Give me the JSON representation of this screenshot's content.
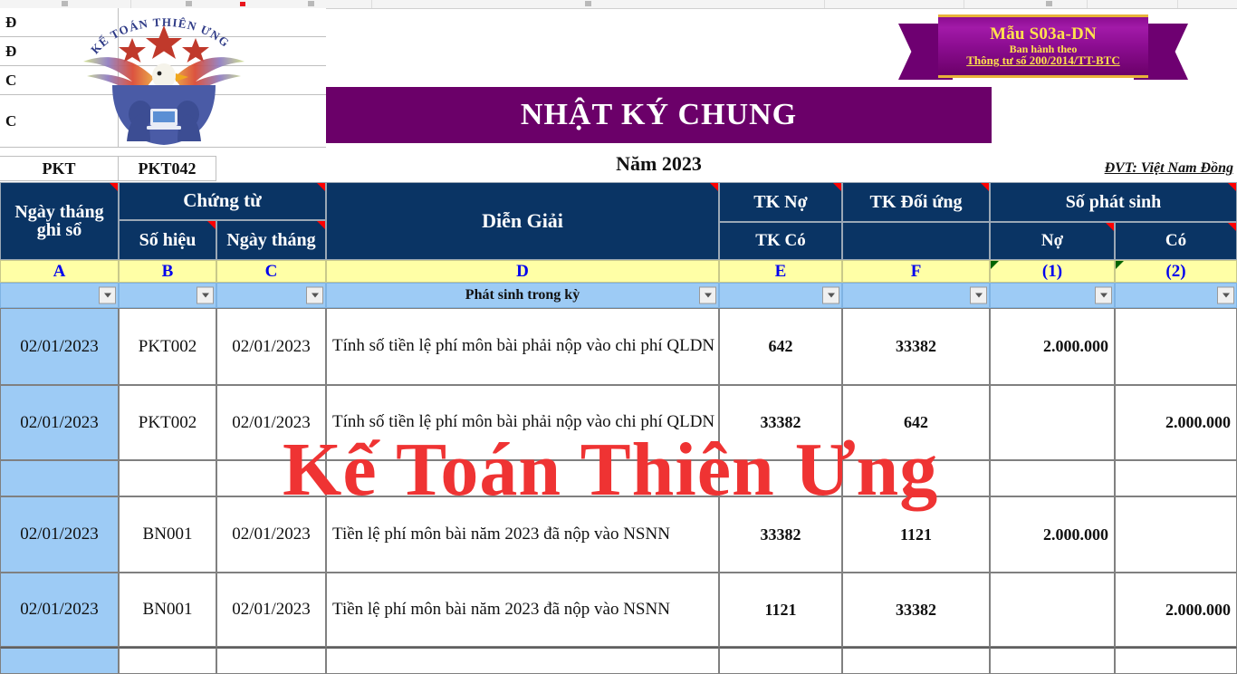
{
  "badge": {
    "line1": "Mẫu S03a-DN",
    "line2": "Ban hành theo",
    "line3": "Thông tư số 200/2014/TT-BTC",
    "colors": {
      "purple": "#6b0069",
      "gold": "#ffe14d",
      "border_gold": "#e8b23a"
    }
  },
  "company_block": {
    "rows": [
      "Đ",
      "Đ",
      "C",
      "C"
    ],
    "voucher_type": "PKT",
    "voucher_no": "PKT042"
  },
  "title": {
    "main": "NHẬT KÝ CHUNG",
    "year": "Năm 2023",
    "unit": "ĐVT: Việt Nam Đồng"
  },
  "colors": {
    "header_navy": "#0a3464",
    "banner_purple": "#6b0069",
    "code_yellow": "#ffffa6",
    "filter_blue": "#9dcbf5",
    "watermark_red": "#ef3333",
    "code_letter_blue": "#0000ee"
  },
  "table": {
    "headers": {
      "date_recorded": "Ngày tháng ghi sổ",
      "voucher_group": "Chứng từ",
      "voucher_no": "Số hiệu",
      "voucher_date": "Ngày tháng",
      "description": "Diễn Giải",
      "tk_no": "TK Nợ",
      "tk_co": "TK Có",
      "tk_doi_ung": "TK Đối ứng",
      "amount_group": "Số phát sinh",
      "amount_debit": "Nợ",
      "amount_credit": "Có"
    },
    "column_codes": [
      "A",
      "B",
      "C",
      "D",
      "E",
      "F",
      "(1)",
      "(2)"
    ],
    "filter_row": {
      "description": "Phát sinh trong kỳ"
    },
    "rows": [
      {
        "date_recorded": "02/01/2023",
        "voucher_no": "PKT002",
        "voucher_date": "02/01/2023",
        "description": "Tính số tiền lệ phí môn bài phải nộp vào chi phí QLDN",
        "tk_no": "642",
        "tk_doi_ung": "33382",
        "debit": "2.000.000",
        "credit": ""
      },
      {
        "date_recorded": "02/01/2023",
        "voucher_no": "PKT002",
        "voucher_date": "02/01/2023",
        "description": "Tính số tiền lệ phí môn bài phải nộp vào chi phí QLDN",
        "tk_no": "33382",
        "tk_doi_ung": "642",
        "debit": "",
        "credit": "2.000.000"
      },
      {
        "date_recorded": "",
        "voucher_no": "",
        "voucher_date": "",
        "description": "",
        "tk_no": "",
        "tk_doi_ung": "",
        "debit": "",
        "credit": ""
      },
      {
        "date_recorded": "02/01/2023",
        "voucher_no": "BN001",
        "voucher_date": "02/01/2023",
        "description": "Tiền lệ phí môn bài năm 2023 đã nộp vào NSNN",
        "tk_no": "33382",
        "tk_doi_ung": "1121",
        "debit": "2.000.000",
        "credit": ""
      },
      {
        "date_recorded": "02/01/2023",
        "voucher_no": "BN001",
        "voucher_date": "02/01/2023",
        "description": "Tiền lệ phí môn bài năm 2023 đã nộp vào NSNN",
        "tk_no": "1121",
        "tk_doi_ung": "33382",
        "debit": "",
        "credit": "2.000.000"
      },
      {
        "date_recorded": "",
        "voucher_no": "",
        "voucher_date": "",
        "description": "",
        "tk_no": "",
        "tk_doi_ung": "",
        "debit": "",
        "credit": ""
      }
    ]
  },
  "watermark": {
    "text": "Kế Toán Thiên Ưng"
  },
  "logo": {
    "text": "KẾ TOÁN THIÊN ƯNG",
    "name": "ke-toan-thien-ung-eagle-logo"
  }
}
